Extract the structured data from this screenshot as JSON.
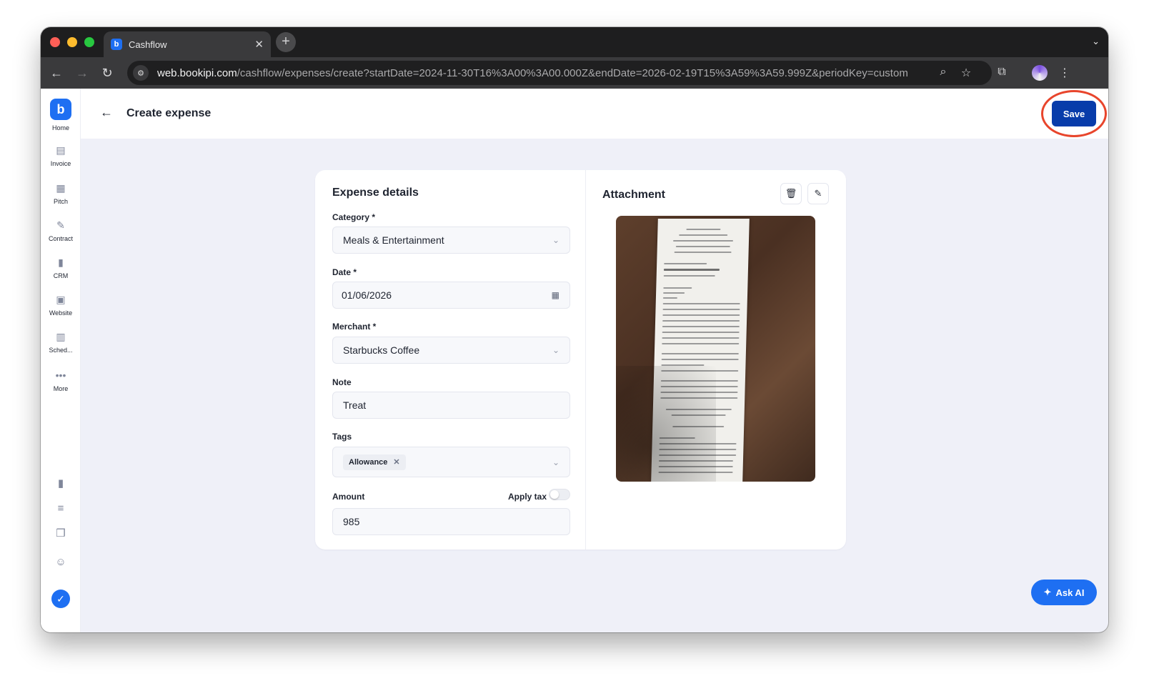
{
  "browser": {
    "tab_title": "Cashflow",
    "url_host": "web.bookipi.com",
    "url_path": "/cashflow/expenses/create?startDate=2024-11-30T16%3A00%3A00.000Z&endDate=2026-02-19T15%3A59%3A59.999Z&periodKey=custom"
  },
  "sidebar": {
    "items": [
      {
        "label": "Home",
        "icon": "bookipi-logo-icon"
      },
      {
        "label": "Invoice",
        "icon": "invoice-icon"
      },
      {
        "label": "Pitch",
        "icon": "pitch-icon"
      },
      {
        "label": "Contract",
        "icon": "contract-icon"
      },
      {
        "label": "CRM",
        "icon": "crm-icon"
      },
      {
        "label": "Website",
        "icon": "website-icon"
      },
      {
        "label": "Sched...",
        "icon": "schedule-icon"
      },
      {
        "label": "More",
        "icon": "more-icon"
      }
    ]
  },
  "header": {
    "title": "Create expense",
    "save_label": "Save"
  },
  "form": {
    "section_title": "Expense details",
    "category_label": "Category *",
    "category_value": "Meals & Entertainment",
    "date_label": "Date *",
    "date_value": "01/06/2026",
    "merchant_label": "Merchant *",
    "merchant_value": "Starbucks Coffee",
    "note_label": "Note",
    "note_value": "Treat",
    "tags_label": "Tags",
    "tags": [
      "Allowance"
    ],
    "amount_label": "Amount",
    "apply_tax_label": "Apply tax",
    "apply_tax_enabled": false,
    "amount_value": "985"
  },
  "attachment": {
    "title": "Attachment"
  },
  "ask_ai": {
    "label": "Ask AI"
  },
  "colors": {
    "primary": "#083caa",
    "accent": "#1e6ff2",
    "highlight": "#e8452c",
    "background": "#eff0f8"
  }
}
